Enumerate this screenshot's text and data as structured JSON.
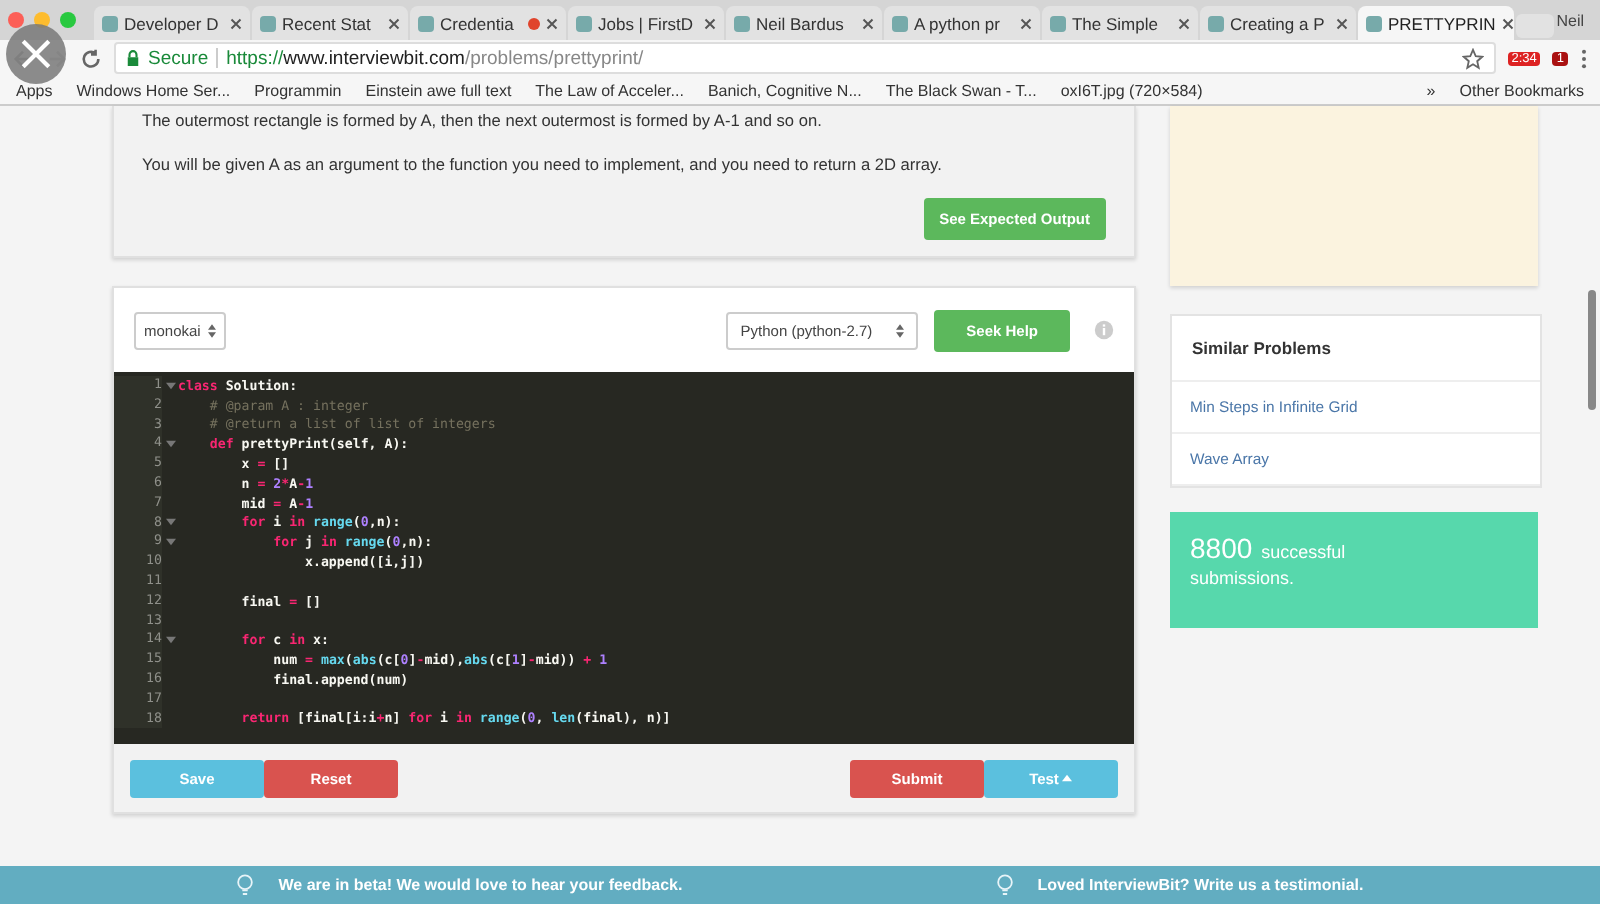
{
  "browser": {
    "tabs": [
      {
        "label": "Developer D",
        "selected": false,
        "recording": false
      },
      {
        "label": "Recent Stat",
        "selected": false,
        "recording": false
      },
      {
        "label": "Credentia",
        "selected": false,
        "recording": true
      },
      {
        "label": "Jobs | FirstD",
        "selected": false,
        "recording": false
      },
      {
        "label": "Neil Bardus",
        "selected": false,
        "recording": false
      },
      {
        "label": "A python pr",
        "selected": false,
        "recording": false
      },
      {
        "label": "The Simple",
        "selected": false,
        "recording": false
      },
      {
        "label": "Creating a P",
        "selected": false,
        "recording": false
      },
      {
        "label": "PRETTYPRIN",
        "selected": true,
        "recording": false
      }
    ],
    "profile": "Neil",
    "secure_label": "Secure",
    "url_scheme": "https://",
    "url_host": "www.interviewbit.com",
    "url_path": "/problems/prettyprint/",
    "extension_badges": [
      "2:34",
      "1"
    ],
    "bookmarks": [
      "Apps",
      "Windows Home Ser...",
      "Programmin",
      "Einstein awe full text",
      "The Law of Acceler...",
      "Banich, Cognitive N...",
      "The Black Swan - T...",
      "oxI6T.jpg (720×584)"
    ],
    "more_bookmarks": "»",
    "other_bookmarks": "Other Bookmarks"
  },
  "problem": {
    "paragraphs": [
      "The outermost rectangle is formed by A, then the next outermost is formed by A-1 and so on.",
      "You will be given A as an argument to the function you need to implement, and you need to return a 2D array."
    ],
    "expected_output_button": "See Expected Output"
  },
  "editor": {
    "theme": "monokai",
    "language": "Python (python-2.7)",
    "seek_help": "Seek Help",
    "lines": [
      {
        "number": "1",
        "foldable": true,
        "tokens": [
          {
            "kind": "kw",
            "text": "class"
          },
          {
            "kind": "tx",
            "text": " Solution:"
          }
        ]
      },
      {
        "number": "2",
        "foldable": false,
        "tokens": [
          {
            "kind": "cm",
            "text": "    # @param A : integer"
          }
        ]
      },
      {
        "number": "3",
        "foldable": false,
        "tokens": [
          {
            "kind": "cm",
            "text": "    # @return a list of list of integers"
          }
        ]
      },
      {
        "number": "4",
        "foldable": true,
        "tokens": [
          {
            "kind": "kw",
            "text": "    def"
          },
          {
            "kind": "tx",
            "text": " prettyPrint(self, A):"
          }
        ]
      },
      {
        "number": "5",
        "foldable": false,
        "tokens": [
          {
            "kind": "tx",
            "text": "        x "
          },
          {
            "kind": "kw",
            "text": "="
          },
          {
            "kind": "tx",
            "text": " []"
          }
        ]
      },
      {
        "number": "6",
        "foldable": false,
        "tokens": [
          {
            "kind": "tx",
            "text": "        n "
          },
          {
            "kind": "kw",
            "text": "="
          },
          {
            "kind": "num",
            "text": " 2"
          },
          {
            "kind": "kw",
            "text": "*"
          },
          {
            "kind": "tx",
            "text": "A"
          },
          {
            "kind": "kw",
            "text": "-"
          },
          {
            "kind": "num",
            "text": "1"
          }
        ]
      },
      {
        "number": "7",
        "foldable": false,
        "tokens": [
          {
            "kind": "tx",
            "text": "        mid "
          },
          {
            "kind": "kw",
            "text": "="
          },
          {
            "kind": "tx",
            "text": " A"
          },
          {
            "kind": "kw",
            "text": "-"
          },
          {
            "kind": "num",
            "text": "1"
          }
        ]
      },
      {
        "number": "8",
        "foldable": true,
        "tokens": [
          {
            "kind": "kw",
            "text": "        for"
          },
          {
            "kind": "tx",
            "text": " i "
          },
          {
            "kind": "kw",
            "text": "in"
          },
          {
            "kind": "fn",
            "text": " range"
          },
          {
            "kind": "tx",
            "text": "("
          },
          {
            "kind": "num",
            "text": "0"
          },
          {
            "kind": "tx",
            "text": ",n):"
          }
        ]
      },
      {
        "number": "9",
        "foldable": true,
        "tokens": [
          {
            "kind": "kw",
            "text": "            for"
          },
          {
            "kind": "tx",
            "text": " j "
          },
          {
            "kind": "kw",
            "text": "in"
          },
          {
            "kind": "fn",
            "text": " range"
          },
          {
            "kind": "tx",
            "text": "("
          },
          {
            "kind": "num",
            "text": "0"
          },
          {
            "kind": "tx",
            "text": ",n):"
          }
        ]
      },
      {
        "number": "10",
        "foldable": false,
        "tokens": [
          {
            "kind": "tx",
            "text": "                x.append([i,j])"
          }
        ]
      },
      {
        "number": "11",
        "foldable": false
      },
      {
        "number": "12",
        "foldable": false,
        "tokens": [
          {
            "kind": "tx",
            "text": "        final "
          },
          {
            "kind": "kw",
            "text": "="
          },
          {
            "kind": "tx",
            "text": " []"
          }
        ]
      },
      {
        "number": "13",
        "foldable": false
      },
      {
        "number": "14",
        "foldable": true,
        "tokens": [
          {
            "kind": "kw",
            "text": "        for"
          },
          {
            "kind": "tx",
            "text": " c "
          },
          {
            "kind": "kw",
            "text": "in"
          },
          {
            "kind": "tx",
            "text": " x:"
          }
        ]
      },
      {
        "number": "15",
        "foldable": false,
        "tokens": [
          {
            "kind": "tx",
            "text": "            num "
          },
          {
            "kind": "kw",
            "text": "="
          },
          {
            "kind": "fn",
            "text": " max"
          },
          {
            "kind": "tx",
            "text": "("
          },
          {
            "kind": "fn",
            "text": "abs"
          },
          {
            "kind": "tx",
            "text": "(c["
          },
          {
            "kind": "num",
            "text": "0"
          },
          {
            "kind": "tx",
            "text": "]"
          },
          {
            "kind": "kw",
            "text": "-"
          },
          {
            "kind": "tx",
            "text": "mid),"
          },
          {
            "kind": "fn",
            "text": "abs"
          },
          {
            "kind": "tx",
            "text": "(c["
          },
          {
            "kind": "num",
            "text": "1"
          },
          {
            "kind": "tx",
            "text": "]"
          },
          {
            "kind": "kw",
            "text": "-"
          },
          {
            "kind": "tx",
            "text": "mid)) "
          },
          {
            "kind": "kw",
            "text": "+"
          },
          {
            "kind": "num",
            "text": " 1"
          }
        ]
      },
      {
        "number": "16",
        "foldable": false,
        "tokens": [
          {
            "kind": "tx",
            "text": "            final.append(num)"
          }
        ]
      },
      {
        "number": "17",
        "foldable": false
      },
      {
        "number": "18",
        "foldable": false,
        "tokens": [
          {
            "kind": "kw",
            "text": "        return"
          },
          {
            "kind": "tx",
            "text": " [final[i:i"
          },
          {
            "kind": "kw",
            "text": "+"
          },
          {
            "kind": "tx",
            "text": "n] "
          },
          {
            "kind": "kw",
            "text": "for"
          },
          {
            "kind": "tx",
            "text": " i "
          },
          {
            "kind": "kw",
            "text": "in"
          },
          {
            "kind": "fn",
            "text": " range"
          },
          {
            "kind": "tx",
            "text": "("
          },
          {
            "kind": "num",
            "text": "0"
          },
          {
            "kind": "tx",
            "text": ", "
          },
          {
            "kind": "fn",
            "text": "len"
          },
          {
            "kind": "tx",
            "text": "(final), n)]"
          }
        ]
      }
    ],
    "save": "Save",
    "reset": "Reset",
    "submit": "Submit",
    "test": "Test"
  },
  "similar_problems": {
    "title": "Similar Problems",
    "items": [
      "Min Steps in Infinite Grid",
      "Wave Array"
    ]
  },
  "submissions": {
    "count": "8800",
    "label": "successful",
    "label_2": "submissions."
  },
  "footer": {
    "left": "We are in beta! We would love to hear your feedback.",
    "right": "Loved InterviewBit? Write us a testimonial."
  }
}
